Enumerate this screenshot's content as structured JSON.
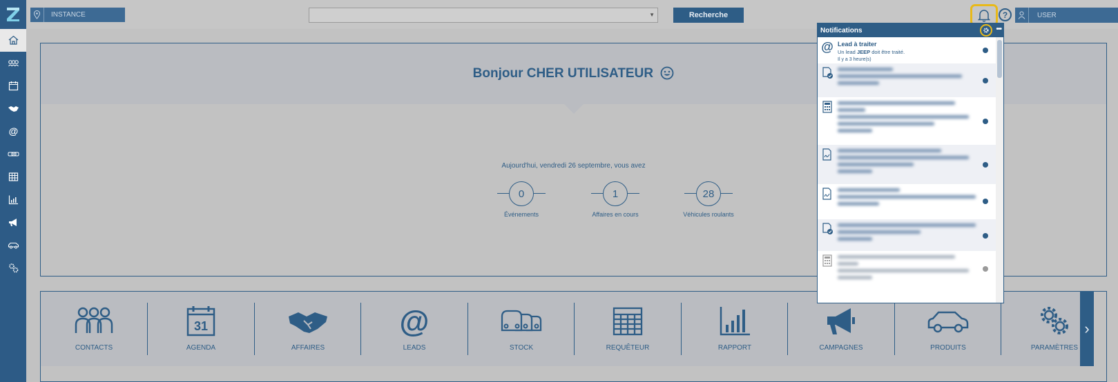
{
  "colors": {
    "brand": "#2e5d86",
    "highlight": "#e8b919",
    "background": "#c2c2c2"
  },
  "sidebar": {
    "items": [
      {
        "icon": "home-icon"
      },
      {
        "icon": "contacts-icon"
      },
      {
        "icon": "calendar-icon"
      },
      {
        "icon": "handshake-icon"
      },
      {
        "icon": "at-icon"
      },
      {
        "icon": "cars-icon"
      },
      {
        "icon": "table-icon"
      },
      {
        "icon": "chart-icon"
      },
      {
        "icon": "megaphone-icon"
      },
      {
        "icon": "car-icon"
      },
      {
        "icon": "gears-icon"
      }
    ]
  },
  "topbar": {
    "instance_label": "INSTANCE",
    "select_value": "",
    "search_button": "Recherche",
    "help_glyph": "?",
    "user_label": "USER"
  },
  "welcome": {
    "title": "Bonjour CHER UTILISATEUR",
    "today": "Aujourd'hui, vendredi 26 septembre, vous avez",
    "stats": [
      {
        "value": "0",
        "label": "Événements"
      },
      {
        "value": "1",
        "label": "Affaires en cours"
      },
      {
        "value": "28",
        "label": "Véhicules roulants"
      }
    ]
  },
  "modules": [
    {
      "label": "CONTACTS",
      "icon": "contacts-icon"
    },
    {
      "label": "AGENDA",
      "icon": "calendar-icon",
      "day": "31"
    },
    {
      "label": "AFFAIRES",
      "icon": "handshake-icon"
    },
    {
      "label": "LEADS",
      "icon": "at-icon"
    },
    {
      "label": "STOCK",
      "icon": "cars-icon"
    },
    {
      "label": "REQUÊTEUR",
      "icon": "table-icon"
    },
    {
      "label": "RAPPORT",
      "icon": "chart-icon"
    },
    {
      "label": "CAMPAGNES",
      "icon": "megaphone-icon"
    },
    {
      "label": "PRODUITS",
      "icon": "car-icon"
    },
    {
      "label": "PARAMÈTRES",
      "icon": "gears-icon"
    }
  ],
  "modules_next": "›",
  "notifications": {
    "title": "Notifications",
    "menu": "•••",
    "items": [
      {
        "icon": "at-icon",
        "title": "Lead à traiter",
        "text_pre": "Un lead ",
        "text_brand": "JEEP",
        "text_post": " doit être traité.",
        "time": "Il y a 3 heure(s)",
        "read": false
      },
      {
        "icon": "document-check-icon",
        "blurred": true,
        "read": false
      },
      {
        "icon": "calculator-icon",
        "blurred": true,
        "read": false
      },
      {
        "icon": "document-sign-icon",
        "blurred": true,
        "read": false
      },
      {
        "icon": "document-sign-icon",
        "blurred": true,
        "read": false
      },
      {
        "icon": "document-check-icon",
        "blurred": true,
        "read": false
      },
      {
        "icon": "calculator-icon",
        "blurred": true,
        "read": true
      }
    ]
  }
}
